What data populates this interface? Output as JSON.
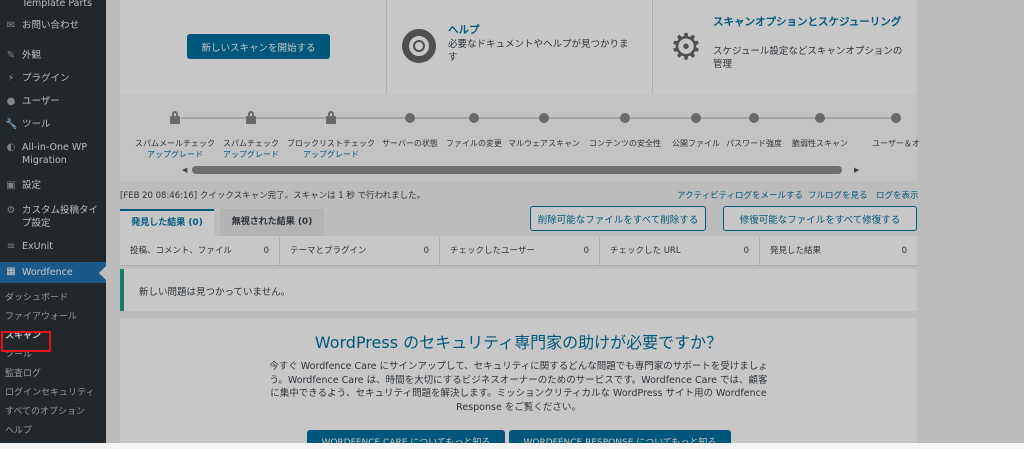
{
  "sidebar": {
    "items": [
      {
        "name": "template-parts",
        "label": "Template Parts",
        "icon": "none"
      },
      {
        "name": "contact",
        "label": "お問い合わせ",
        "icon": "mail-icon"
      },
      {
        "name": "appearance",
        "label": "外観",
        "icon": "brush-icon"
      },
      {
        "name": "plugins",
        "label": "プラグイン",
        "icon": "plugin-icon"
      },
      {
        "name": "users",
        "label": "ユーザー",
        "icon": "user-icon"
      },
      {
        "name": "tools",
        "label": "ツール",
        "icon": "wrench-icon"
      },
      {
        "name": "all-in-one",
        "label": "All-in-One WP Migration",
        "icon": "migration-icon"
      },
      {
        "name": "settings",
        "label": "設定",
        "icon": "settings-icon"
      },
      {
        "name": "custom-post",
        "label": "カスタム投稿タイプ設定",
        "icon": "gear-icon"
      },
      {
        "name": "exunit",
        "label": "ExUnit",
        "icon": "exunit-icon"
      },
      {
        "name": "wordfence",
        "label": "Wordfence",
        "icon": "wordfence-icon"
      }
    ],
    "submenu": [
      "ダッシュボード",
      "ファイアウォール",
      "スキャン",
      "ツール",
      "監査ログ",
      "ログインセキュリティ",
      "すべてのオプション",
      "ヘルプ"
    ],
    "current_sub": "スキャン"
  },
  "top": {
    "start_scan": "新しいスキャンを開始する",
    "help_title": "ヘルプ",
    "help_desc": "必要なドキュメントやヘルプが見つかります",
    "options_title": "スキャンオプションとスケジューリング",
    "options_desc": "スケジュール設定などスキャンオプションの管理"
  },
  "steps": [
    {
      "label": "スパムメールチェック",
      "sub": "アップグレード",
      "kind": "lock"
    },
    {
      "label": "スパムチェック",
      "sub": "アップグレード",
      "kind": "lock"
    },
    {
      "label": "ブロックリストチェック",
      "sub": "アップグレード",
      "kind": "lock"
    },
    {
      "label": "サーバーの状態",
      "sub": "",
      "kind": "dot"
    },
    {
      "label": "ファイルの変更",
      "sub": "",
      "kind": "dot"
    },
    {
      "label": "マルウェアスキャン",
      "sub": "",
      "kind": "dot"
    },
    {
      "label": "コンテンツの安全性",
      "sub": "",
      "kind": "dot"
    },
    {
      "label": "公開ファイル",
      "sub": "",
      "kind": "dot"
    },
    {
      "label": "パスワード強度",
      "sub": "",
      "kind": "dot"
    },
    {
      "label": "脆弱性スキャン",
      "sub": "",
      "kind": "dot"
    },
    {
      "label": "ユーザー＆オ",
      "sub": "",
      "kind": "dot"
    }
  ],
  "status": {
    "message": "[FEB 20 08:46:16] クイックスキャン完了。スキャンは 1 秒 で行われました。",
    "email_log": "アクティビティログをメールする",
    "full_log": "フルログを見る",
    "show_log": "ログを表示"
  },
  "tabs": {
    "found": "発見した結果 (0)",
    "ignored": "無視された結果 (0)"
  },
  "actions": {
    "delete_all": "削除可能なファイルをすべて削除する",
    "repair_all": "修復可能なファイルをすべて修復する"
  },
  "stats": [
    {
      "label": "投稿、コメント、ファイル",
      "value": "0"
    },
    {
      "label": "テーマとプラグイン",
      "value": "0"
    },
    {
      "label": "チェックしたユーザー",
      "value": "0"
    },
    {
      "label": "チェックした URL",
      "value": "0"
    },
    {
      "label": "発見した結果",
      "value": "0"
    }
  ],
  "no_issues": "新しい問題は見つかっていません。",
  "care": {
    "title": "WordPress のセキュリティ専門家の助けが必要ですか？",
    "body": "今すぐ Wordfence Care にサインアップして、セキュリティに関するどんな問題でも専門家のサポートを受けましょう。Wordfence Care は、時間を大切にするビジネスオーナーのためのサービスです。Wordfence Care では、顧客に集中できるよう、セキュリティ問題を解決します。ミッションクリティカルな WordPress サイト用の Wordfence Response をご覧ください。",
    "btn_care": "WORDFENCE CARE についてもっと知る",
    "btn_response": "WORDFENCE RESPONSE についてもっと知る"
  },
  "colors": {
    "accent": "#00709e",
    "wordfence_orange": "#f36e2b",
    "sidebar_bg": "#2c3338",
    "highlight_red": "#e3141b"
  }
}
